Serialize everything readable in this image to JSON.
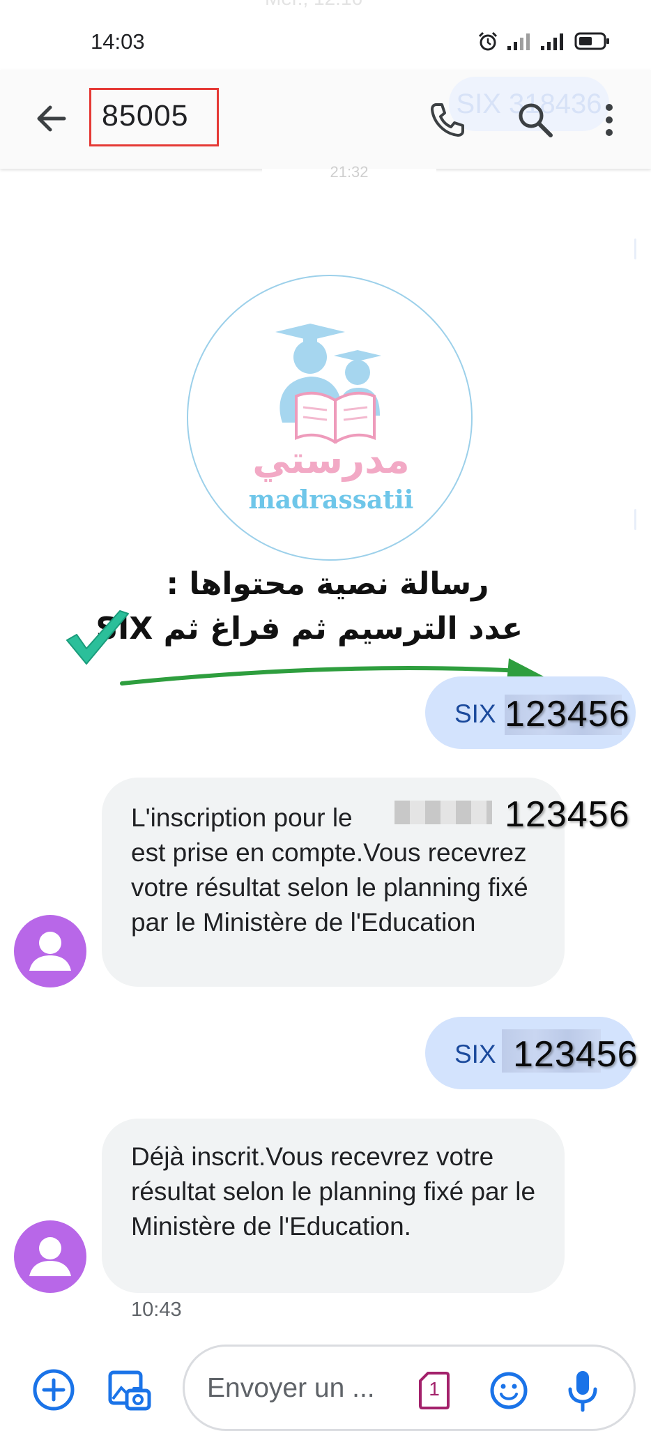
{
  "status_bar": {
    "time": "14:03"
  },
  "ghost": {
    "top_text": "Mer., 12:16",
    "six_label": "SIX 318436",
    "date_label": "21:32"
  },
  "header": {
    "title": "85005"
  },
  "icons": {
    "back": "arrow-back-icon",
    "call": "phone-icon",
    "search": "search-icon",
    "more": "more-vert-icon",
    "alarm": "alarm-icon",
    "signal": "signal-icon",
    "battery": "battery-icon",
    "add": "add-circle-icon",
    "gallery": "gallery-icon",
    "sim": "sim-card-icon",
    "emoji": "emoji-icon",
    "mic": "microphone-icon",
    "avatar": "person-icon"
  },
  "logo": {
    "arabic": "مدرستي",
    "latin": "madrassatii"
  },
  "annotation": {
    "line1": "رسالة نصية محتواها :",
    "line2": "عدد الترسيم ثم فراغ ثم SIX"
  },
  "messages": [
    {
      "direction": "outgoing",
      "prefix": "SIX",
      "number": "123456"
    },
    {
      "direction": "incoming",
      "line1": "L'inscription pour le",
      "number": "123456",
      "rest": "est prise en compte.Vous recevrez votre résultat selon le planning fixé par le Ministère de l'Education"
    },
    {
      "direction": "outgoing",
      "prefix": "SIX",
      "number": "123456"
    },
    {
      "direction": "incoming",
      "text": "Déjà inscrit.Vous recevrez votre résultat selon le planning fixé par le Ministère de l'Education."
    }
  ],
  "timestamp": "10:43",
  "compose": {
    "placeholder": "Envoyer un ...",
    "sim_number": "1"
  },
  "colors": {
    "outgoing_bubble": "#d3e3fd",
    "incoming_bubble": "#f1f3f4",
    "avatar": "#b867e8",
    "accent_blue": "#1a73e8",
    "highlight_red": "#e53935",
    "arrow_green": "#2e9e3e",
    "check_teal": "#2bbf9a",
    "sim_magenta": "#a3216b"
  }
}
